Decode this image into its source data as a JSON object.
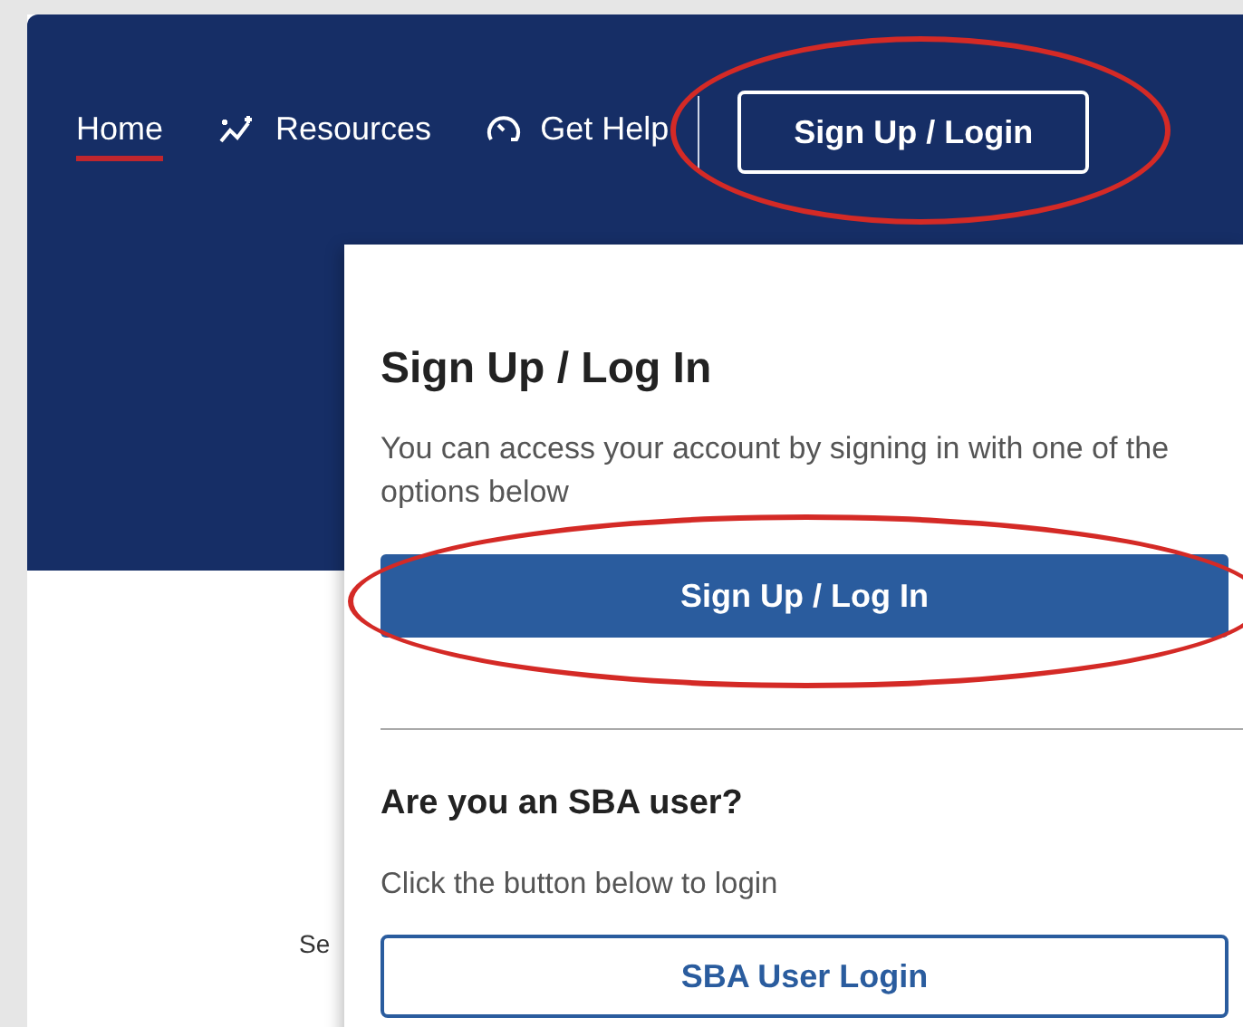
{
  "nav": {
    "items": [
      {
        "label": "Home",
        "kind": "plain",
        "selected": true
      },
      {
        "label": "Resources",
        "kind": "chart",
        "selected": false
      },
      {
        "label": "Get Help",
        "kind": "help",
        "selected": false
      }
    ],
    "login_button": {
      "label": "Sign Up / Login",
      "highlighted": true
    }
  },
  "page_text": "Se",
  "dropdown": {
    "title": "Sign Up / Log In",
    "description": "You can access your account by signing in with one of the options below",
    "primary_button": {
      "label": "Sign Up / Log In",
      "highlighted": true
    },
    "section_title": "Are you an SBA user?",
    "section_text": "Click the button below to login",
    "secondary_button": {
      "label": "SBA User Login"
    }
  }
}
